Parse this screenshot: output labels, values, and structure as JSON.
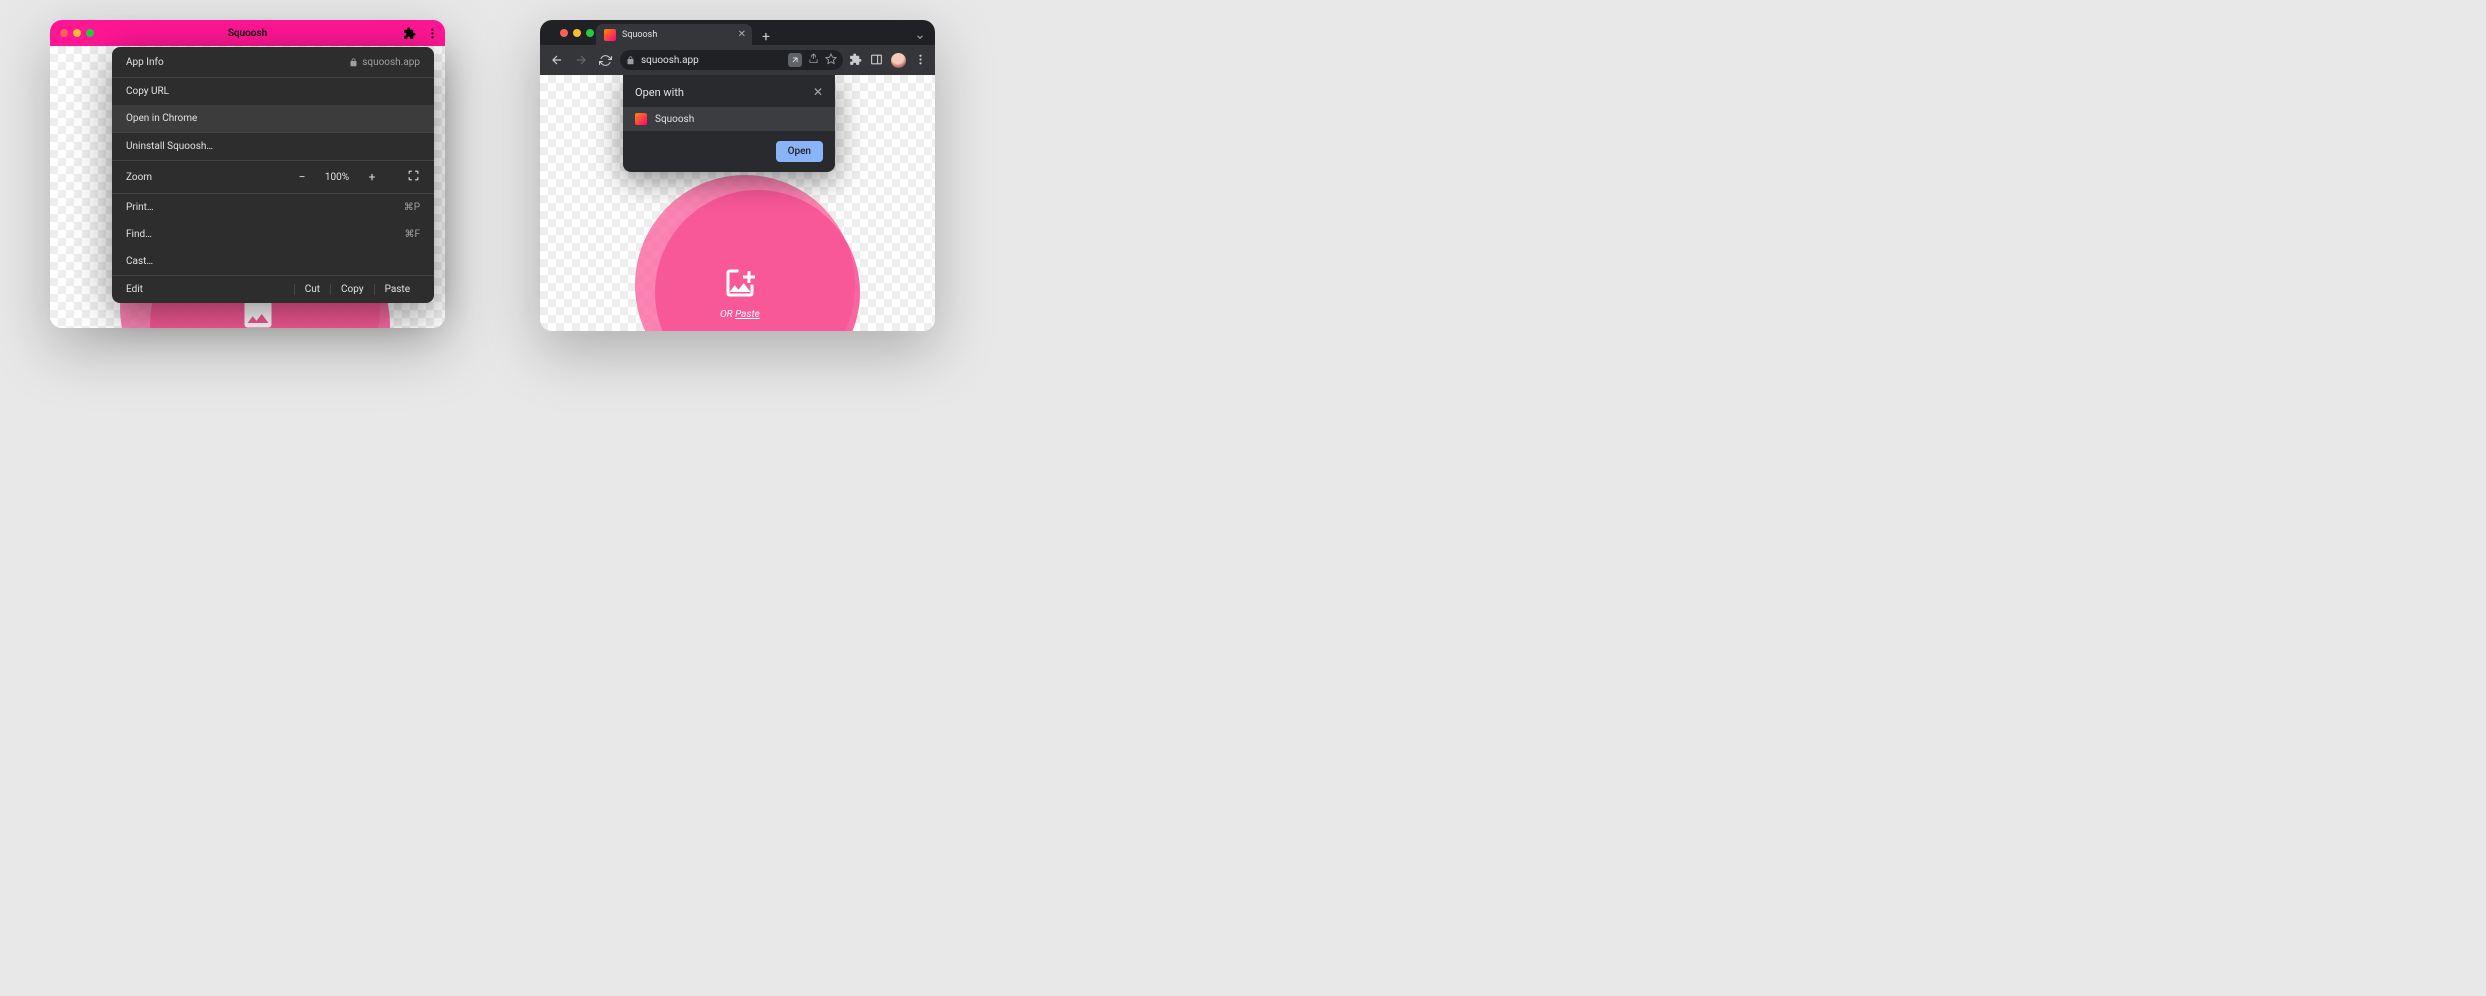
{
  "left": {
    "title": "Squoosh",
    "menu": {
      "app_info": "App Info",
      "domain": "squoosh.app",
      "copy_url": "Copy URL",
      "open_in_chrome": "Open in Chrome",
      "uninstall": "Uninstall Squoosh…",
      "zoom": "Zoom",
      "zoom_value": "100%",
      "print": "Print…",
      "print_short": "⌘P",
      "find": "Find…",
      "find_short": "⌘F",
      "cast": "Cast…",
      "edit": "Edit",
      "cut": "Cut",
      "copy": "Copy",
      "paste": "Paste"
    }
  },
  "right": {
    "tab_title": "Squoosh",
    "url": "squoosh.app",
    "openwith": {
      "title": "Open with",
      "item": "Squoosh",
      "open": "Open"
    },
    "drop": {
      "or": "OR ",
      "paste": "Paste"
    }
  }
}
